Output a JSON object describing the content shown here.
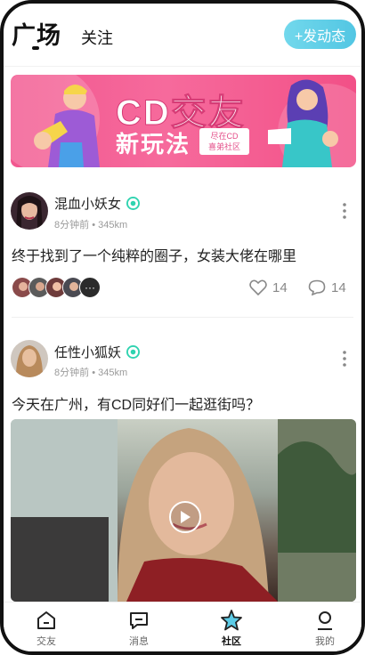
{
  "header": {
    "tab_main": "广场",
    "tab_follow": "关注",
    "post_button": "+发动态"
  },
  "banner": {
    "title": "CD交友",
    "subtitle": "新玩法",
    "tag_line1": "尽在CD",
    "tag_line2": "喜弟社区"
  },
  "posts": [
    {
      "username": "混血小妖女",
      "time": "8分钟前",
      "distance": "345km",
      "text": "终于找到了一个纯粹的圈子，女装大佬在哪里",
      "likes": "14",
      "comments": "14",
      "more_avatars_label": "···"
    },
    {
      "username": "任性小狐妖",
      "time": "8分钟前",
      "distance": "345km",
      "text": "今天在广州，有CD同好们一起逛街吗？"
    }
  ],
  "tabbar": {
    "items": [
      {
        "label": "交友",
        "icon": "home-icon"
      },
      {
        "label": "消息",
        "icon": "message-icon"
      },
      {
        "label": "社区",
        "icon": "community-star-icon"
      },
      {
        "label": "我的",
        "icon": "profile-icon"
      }
    ],
    "active_index": 2
  },
  "colors": {
    "accent": "#5ccbe6",
    "banner": "#f2578f",
    "vip_badge": "#2fd3b0"
  }
}
